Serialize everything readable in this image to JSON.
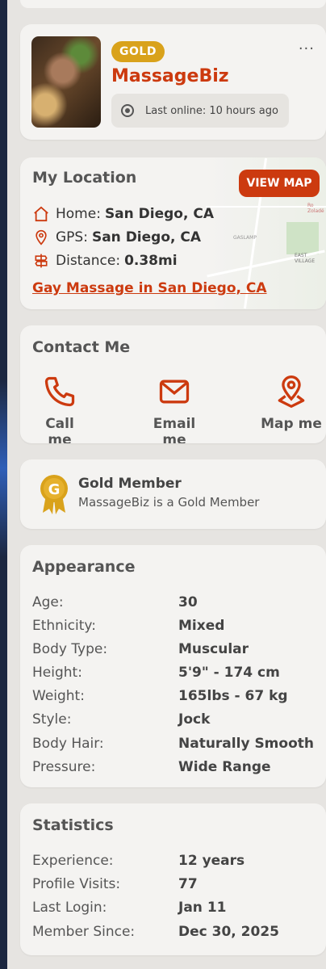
{
  "profile": {
    "badge": "GOLD",
    "name": "MassageBiz",
    "last_online": "Last online: 10 hours ago",
    "more_icon": "···"
  },
  "location": {
    "title": "My Location",
    "view_map": "VIEW MAP",
    "home_label": "Home:",
    "home_value": "San Diego, CA",
    "gps_label": "GPS:",
    "gps_value": "San Diego, CA",
    "distance_label": "Distance:",
    "distance_value": "0.38mi",
    "link": "Gay Massage in San Diego, CA"
  },
  "contact": {
    "title": "Contact Me",
    "call": "Call me",
    "email": "Email me",
    "map": "Map me"
  },
  "gold": {
    "title": "Gold Member",
    "subtitle": "MassageBiz is a Gold Member",
    "medal_letter": "G"
  },
  "appearance": {
    "title": "Appearance",
    "rows": [
      {
        "label": "Age:",
        "value": "30"
      },
      {
        "label": "Ethnicity:",
        "value": "Mixed"
      },
      {
        "label": "Body Type:",
        "value": "Muscular"
      },
      {
        "label": "Height:",
        "value": "5'9\" - 174 cm"
      },
      {
        "label": "Weight:",
        "value": "165lbs - 67 kg"
      },
      {
        "label": "Style:",
        "value": "Jock"
      },
      {
        "label": "Body Hair:",
        "value": "Naturally Smooth"
      },
      {
        "label": "Pressure:",
        "value": "Wide Range"
      }
    ]
  },
  "statistics": {
    "title": "Statistics",
    "rows": [
      {
        "label": "Experience:",
        "value": "12 years"
      },
      {
        "label": "Profile Visits:",
        "value": "77"
      },
      {
        "label": "Last Login:",
        "value": "Jan 11"
      },
      {
        "label": "Member Since:",
        "value": "Dec 30, 2025"
      }
    ]
  },
  "map_labels": {
    "a": "EAST VILLAGE",
    "b": "GASLAMP",
    "c": "Ro Zoladé"
  },
  "colors": {
    "accent": "#cc3a0f",
    "gold": "#d9a21b",
    "card": "#f4f3f1",
    "background": "#e6e4e1"
  }
}
